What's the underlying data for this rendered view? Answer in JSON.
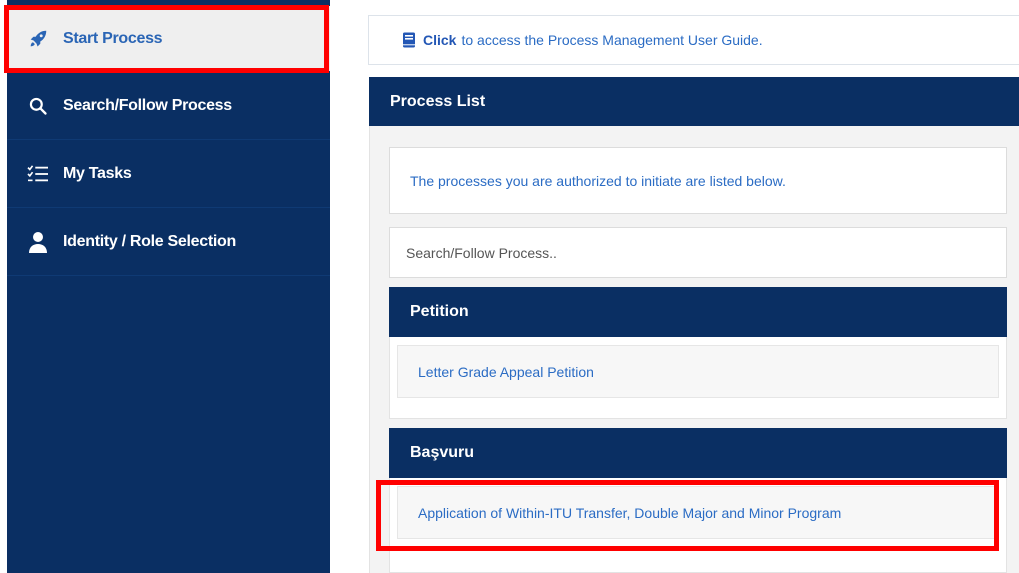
{
  "sidebar": {
    "items": [
      {
        "label": "Start Process",
        "icon": "rocket-icon",
        "active": true
      },
      {
        "label": "Search/Follow Process",
        "icon": "search-icon"
      },
      {
        "label": "My Tasks",
        "icon": "task-list-icon"
      },
      {
        "label": "Identity / Role Selection",
        "icon": "user-icon"
      }
    ]
  },
  "guide": {
    "link_label": "Click",
    "text": "to access the Process Management User Guide.",
    "icon": "book-icon"
  },
  "process_list": {
    "title": "Process List",
    "info_text": "The processes you are authorized to initiate are listed below.",
    "search_placeholder": "Search/Follow Process..",
    "groups": [
      {
        "title": "Petition",
        "items": [
          "Letter Grade Appeal Petition"
        ]
      },
      {
        "title": "Başvuru",
        "items": [
          "Application of Within-ITU Transfer, Double Major and Minor Program"
        ]
      }
    ]
  },
  "colors": {
    "navy": "#0a2f63",
    "link_blue": "#2b6cc4",
    "highlight_red": "#ff0000"
  }
}
